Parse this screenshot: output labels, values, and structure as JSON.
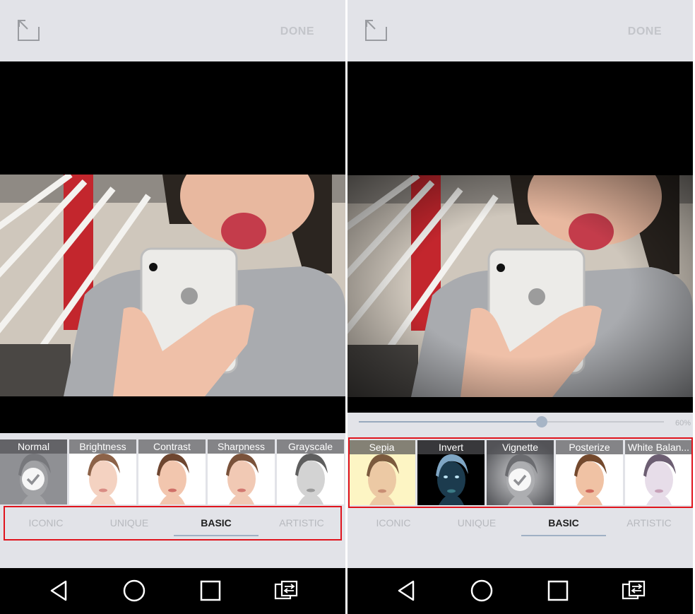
{
  "panels": [
    {
      "done_label": "DONE",
      "filters": [
        {
          "label": "Normal",
          "style": "normal",
          "selected": true
        },
        {
          "label": "Brightness",
          "style": "bright",
          "selected": false
        },
        {
          "label": "Contrast",
          "style": "contrast",
          "selected": false
        },
        {
          "label": "Sharpness",
          "style": "sharp",
          "selected": false
        },
        {
          "label": "Grayscale",
          "style": "gray",
          "selected": false
        }
      ],
      "tabs": [
        {
          "label": "ICONIC",
          "active": false
        },
        {
          "label": "UNIQUE",
          "active": false
        },
        {
          "label": "BASIC",
          "active": true
        },
        {
          "label": "ARTISTIC",
          "active": false
        }
      ],
      "highlight": "tabs"
    },
    {
      "done_label": "DONE",
      "slider_value": "60%",
      "slider_fraction": 0.6,
      "filters": [
        {
          "label": "Sepia",
          "style": "sepia",
          "selected": false
        },
        {
          "label": "Invert",
          "style": "invert",
          "selected": false
        },
        {
          "label": "Vignette",
          "style": "vignette",
          "selected": true
        },
        {
          "label": "Posterize",
          "style": "poster",
          "selected": false
        },
        {
          "label": "White Balan...",
          "style": "white",
          "selected": false
        }
      ],
      "tabs": [
        {
          "label": "ICONIC",
          "active": false
        },
        {
          "label": "UNIQUE",
          "active": false
        },
        {
          "label": "BASIC",
          "active": true
        },
        {
          "label": "ARTISTIC",
          "active": false
        }
      ],
      "highlight": "filters"
    }
  ],
  "icons": [
    "expand-icon",
    "checkmark-icon",
    "back-icon",
    "home-icon",
    "recents-icon",
    "switch-screen-icon"
  ],
  "colors": {
    "highlight": "#e0141d",
    "tab_underline": "#9fb0c4",
    "background": "#e2e3e8",
    "slider": "#a7b5c6"
  }
}
